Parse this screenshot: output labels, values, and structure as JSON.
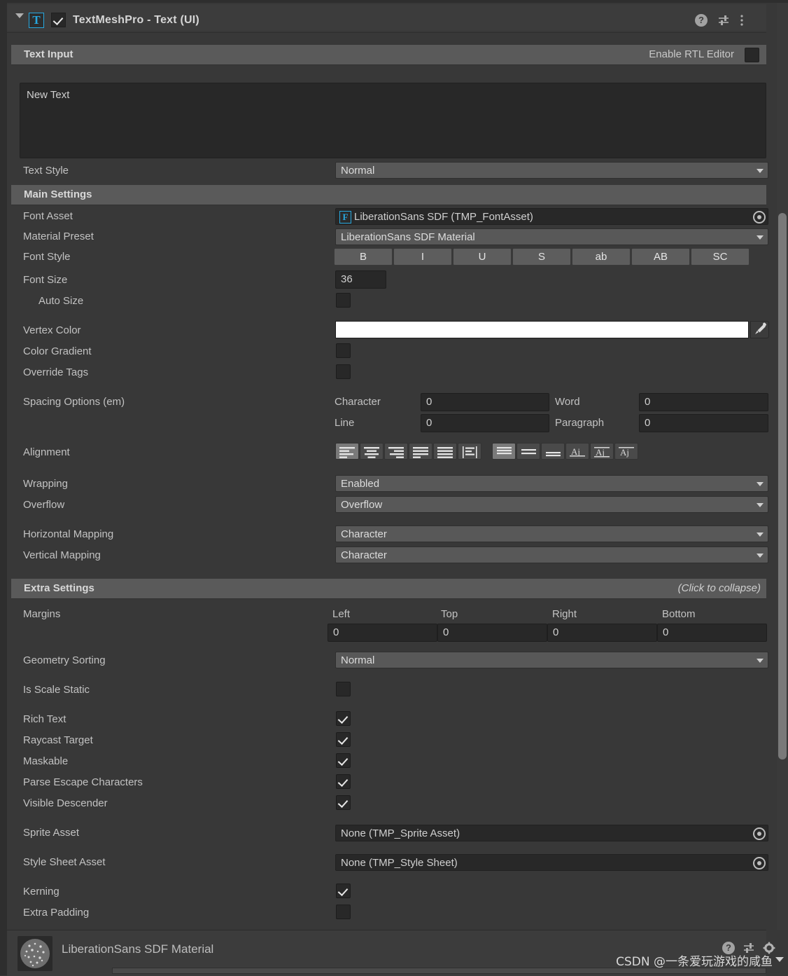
{
  "component": {
    "title": "TextMeshPro - Text (UI)",
    "icon_label": "T",
    "enabled": true,
    "header_icons": [
      "help-icon",
      "preset-icon",
      "more-menu-icon"
    ]
  },
  "text_input_section": {
    "title": "Text Input",
    "rtl_label": "Enable RTL Editor",
    "rtl_checked": false,
    "text_value": "New Text"
  },
  "text_style": {
    "label": "Text Style",
    "value": "Normal"
  },
  "main_settings": {
    "title": "Main Settings",
    "font_asset": {
      "label": "Font Asset",
      "badge": "F",
      "value": "LiberationSans SDF (TMP_FontAsset)"
    },
    "material_preset": {
      "label": "Material Preset",
      "value": "LiberationSans SDF Material"
    },
    "font_style": {
      "label": "Font Style",
      "buttons": [
        "B",
        "I",
        "U",
        "S",
        "ab",
        "AB",
        "SC"
      ]
    },
    "font_size": {
      "label": "Font Size",
      "value": "36"
    },
    "auto_size": {
      "label": "Auto Size",
      "checked": false
    },
    "vertex_color": {
      "label": "Vertex Color",
      "value": "#FFFFFF"
    },
    "color_gradient": {
      "label": "Color Gradient",
      "checked": false
    },
    "override_tags": {
      "label": "Override Tags",
      "checked": false
    },
    "spacing_options": {
      "label": "Spacing Options (em)",
      "fields": [
        {
          "label": "Character",
          "value": "0"
        },
        {
          "label": "Word",
          "value": "0"
        },
        {
          "label": "Line",
          "value": "0"
        },
        {
          "label": "Paragraph",
          "value": "0"
        }
      ]
    },
    "alignment": {
      "label": "Alignment",
      "horizontal": [
        "align-left",
        "align-center",
        "align-right",
        "align-justified",
        "align-flush",
        "align-geometry-center"
      ],
      "horizontal_selected": 0,
      "vertical": [
        "align-top",
        "align-middle",
        "align-bottom",
        "align-baseline",
        "align-midline",
        "align-capline"
      ],
      "vertical_selected": 0
    },
    "wrapping": {
      "label": "Wrapping",
      "value": "Enabled"
    },
    "overflow": {
      "label": "Overflow",
      "value": "Overflow"
    },
    "horizontal_mapping": {
      "label": "Horizontal Mapping",
      "value": "Character"
    },
    "vertical_mapping": {
      "label": "Vertical Mapping",
      "value": "Character"
    }
  },
  "extra_settings": {
    "title": "Extra Settings",
    "collapse_hint": "(Click to collapse)",
    "margins": {
      "label": "Margins",
      "fields": [
        {
          "label": "Left",
          "value": "0"
        },
        {
          "label": "Top",
          "value": "0"
        },
        {
          "label": "Right",
          "value": "0"
        },
        {
          "label": "Bottom",
          "value": "0"
        }
      ]
    },
    "geometry_sorting": {
      "label": "Geometry Sorting",
      "value": "Normal"
    },
    "is_scale_static": {
      "label": "Is Scale Static",
      "checked": false
    },
    "toggles": [
      {
        "label": "Rich Text",
        "checked": true
      },
      {
        "label": "Raycast Target",
        "checked": true
      },
      {
        "label": "Maskable",
        "checked": true
      },
      {
        "label": "Parse Escape Characters",
        "checked": true
      },
      {
        "label": "Visible Descender",
        "checked": true
      }
    ],
    "sprite_asset": {
      "label": "Sprite Asset",
      "value": "None (TMP_Sprite Asset)"
    },
    "style_sheet_asset": {
      "label": "Style Sheet Asset",
      "value": "None (TMP_Style Sheet)"
    },
    "kerning": {
      "label": "Kerning",
      "checked": true
    },
    "extra_padding": {
      "label": "Extra Padding",
      "checked": false
    }
  },
  "material_footer": {
    "title": "LiberationSans SDF Material",
    "icons": [
      "help-icon",
      "preset-icon",
      "gear-icon"
    ]
  },
  "watermark": {
    "text": "CSDN @一条爱玩游戏的咸鱼"
  },
  "colors": {
    "panel_bg": "#383838",
    "header_bg": "#3c3c3c",
    "section_bar": "#5a5a5a",
    "field_bg": "#282828",
    "dropdown_bg": "#585858",
    "accent_blue": "#27a8e0",
    "text": "#c2c2c2"
  }
}
